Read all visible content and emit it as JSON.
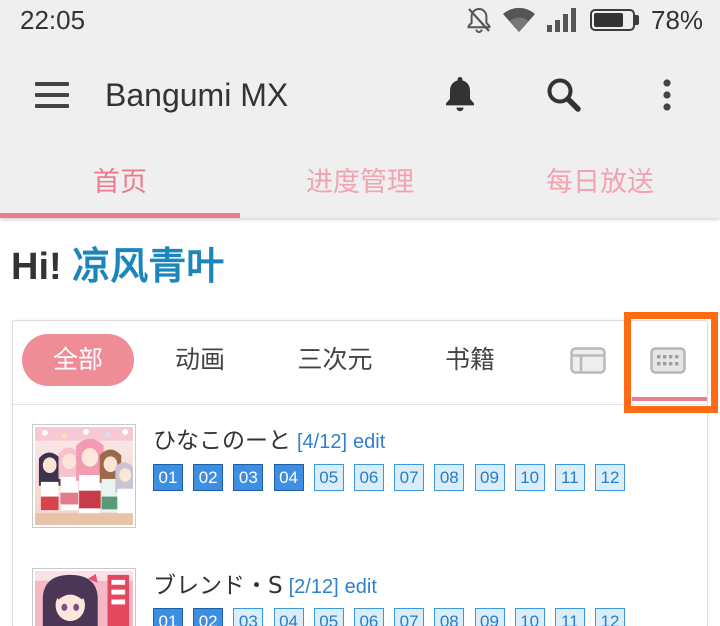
{
  "status_bar": {
    "time": "22:05",
    "battery": "78%",
    "icons": [
      "mute-icon",
      "wifi-icon",
      "signal-icon",
      "battery-icon"
    ]
  },
  "app_bar": {
    "title": "Bangumi MX",
    "icons": [
      "menu-icon",
      "notifications-icon",
      "search-icon",
      "more-vert-icon"
    ]
  },
  "tabs": [
    {
      "label": "首页",
      "active": true
    },
    {
      "label": "进度管理",
      "active": false
    },
    {
      "label": "每日放送",
      "active": false
    }
  ],
  "greeting": {
    "prefix": "Hi!",
    "username": "凉风青叶"
  },
  "collection": {
    "filters": [
      {
        "label": "全部",
        "active": true
      },
      {
        "label": "动画",
        "active": false
      },
      {
        "label": "三次元",
        "active": false
      },
      {
        "label": "书籍",
        "active": false
      }
    ],
    "view_modes": [
      {
        "icon": "list-view-icon",
        "active": false
      },
      {
        "icon": "grid-view-icon",
        "active": true
      }
    ],
    "items": [
      {
        "title": "ひなこのーと",
        "progress": "[4/12]",
        "edit_label": "edit",
        "watched": 4,
        "episodes": [
          "01",
          "02",
          "03",
          "04",
          "05",
          "06",
          "07",
          "08",
          "09",
          "10",
          "11",
          "12"
        ]
      },
      {
        "title": "ブレンド・S",
        "progress": "[2/12]",
        "edit_label": "edit",
        "watched": 2,
        "episodes": [
          "01",
          "02",
          "03",
          "04",
          "05",
          "06",
          "07",
          "08",
          "09",
          "10",
          "11",
          "12"
        ]
      }
    ]
  },
  "colors": {
    "accent": "#ec7b8e",
    "tab_inactive": "#f2a3b2",
    "filter_pill": "#ef8d96",
    "username": "#1b86bb",
    "link": "#2f80cf",
    "episode_watched": "#3c8fe2",
    "episode_watched_border": "#1f5ea6",
    "episode_unwatched": "#d9edfb",
    "episode_unwatched_border": "#3a97e0",
    "episode_unwatched_text": "#2a7cc4",
    "highlight": "#ff6a14"
  }
}
